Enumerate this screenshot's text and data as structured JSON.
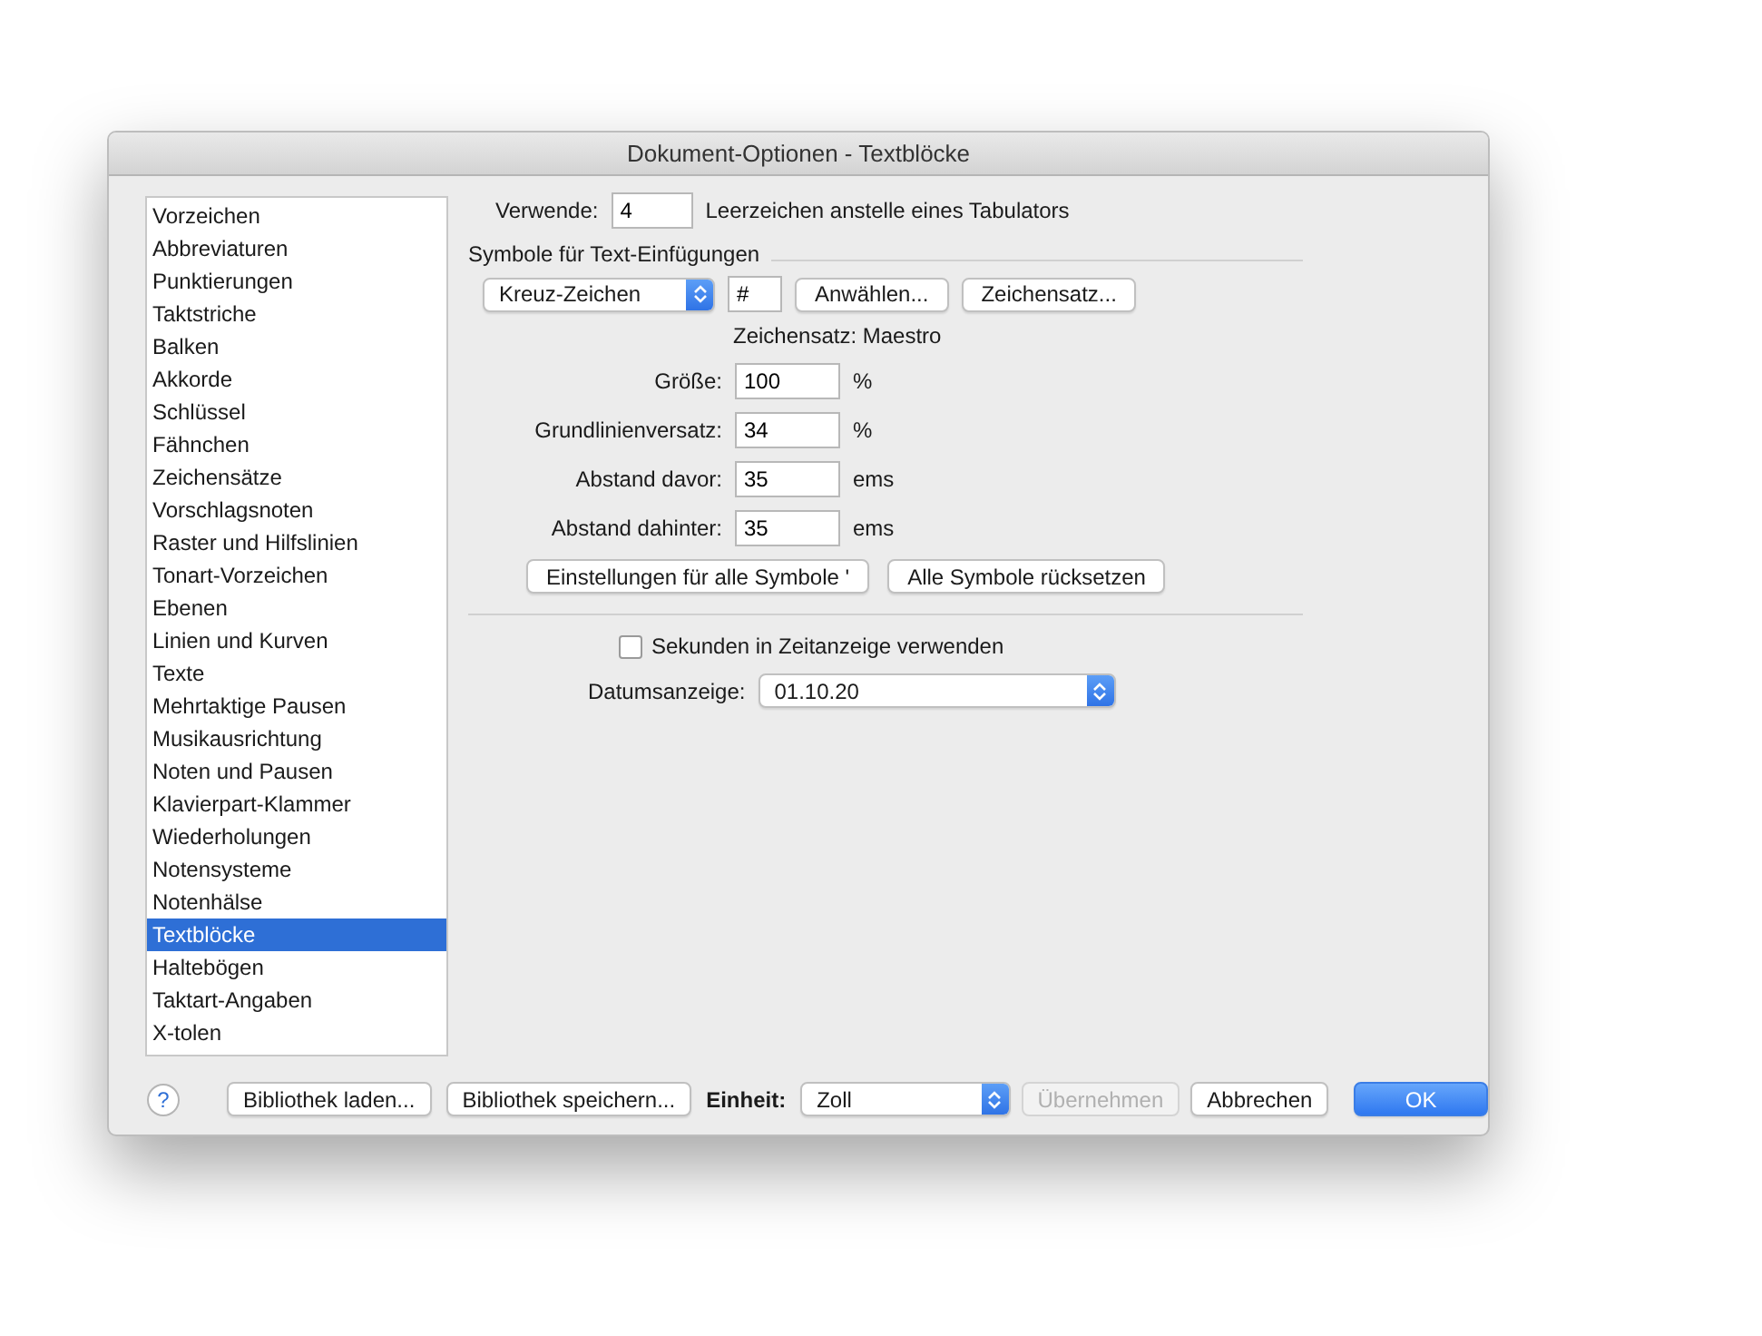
{
  "window": {
    "title": "Dokument-Optionen - Textblöcke"
  },
  "sidebar": {
    "items": [
      {
        "label": "Vorzeichen",
        "selected": false
      },
      {
        "label": "Abbreviaturen",
        "selected": false
      },
      {
        "label": "Punktierungen",
        "selected": false
      },
      {
        "label": "Taktstriche",
        "selected": false
      },
      {
        "label": "Balken",
        "selected": false
      },
      {
        "label": "Akkorde",
        "selected": false
      },
      {
        "label": "Schlüssel",
        "selected": false
      },
      {
        "label": "Fähnchen",
        "selected": false
      },
      {
        "label": "Zeichensätze",
        "selected": false
      },
      {
        "label": "Vorschlagsnoten",
        "selected": false
      },
      {
        "label": "Raster und Hilfslinien",
        "selected": false
      },
      {
        "label": "Tonart-Vorzeichen",
        "selected": false
      },
      {
        "label": "Ebenen",
        "selected": false
      },
      {
        "label": "Linien und Kurven",
        "selected": false
      },
      {
        "label": "Texte",
        "selected": false
      },
      {
        "label": "Mehrtaktige Pausen",
        "selected": false
      },
      {
        "label": "Musikausrichtung",
        "selected": false
      },
      {
        "label": "Noten und Pausen",
        "selected": false
      },
      {
        "label": "Klavierpart-Klammer",
        "selected": false
      },
      {
        "label": "Wiederholungen",
        "selected": false
      },
      {
        "label": "Notensysteme",
        "selected": false
      },
      {
        "label": "Notenhälse",
        "selected": false
      },
      {
        "label": "Textblöcke",
        "selected": true
      },
      {
        "label": "Haltebögen",
        "selected": false
      },
      {
        "label": "Taktart-Angaben",
        "selected": false
      },
      {
        "label": "X-tolen",
        "selected": false
      }
    ]
  },
  "spaces": {
    "label": "Verwende:",
    "value": "4",
    "suffix": "Leerzeichen anstelle eines Tabulators"
  },
  "symbols": {
    "heading": "Symbole für Text-Einfügungen",
    "popup": "Kreuz-Zeichen",
    "character": "#",
    "buttons": [
      "Anwählen...",
      "Zeichensatz..."
    ],
    "font_info": "Zeichensatz: Maestro",
    "fields": [
      {
        "label": "Größe:",
        "value": "100",
        "unit": "%"
      },
      {
        "label": "Grundlinienversatz:",
        "value": "34",
        "unit": "%"
      },
      {
        "label": "Abstand davor:",
        "value": "35",
        "unit": "ems"
      },
      {
        "label": "Abstand dahinter:",
        "value": "35",
        "unit": "ems"
      }
    ],
    "actions": [
      "Einstellungen für alle Symbole '",
      "Alle Symbole rücksetzen"
    ]
  },
  "seconds": {
    "label": "Sekunden in Zeitanzeige verwenden",
    "checked": false
  },
  "date": {
    "label": "Datumsanzeige:",
    "value": "01.10.20"
  },
  "footer": {
    "help": "?",
    "library_buttons": [
      "Bibliothek laden...",
      "Bibliothek speichern..."
    ],
    "unit_label": "Einheit:",
    "unit_value": "Zoll",
    "buttons": [
      {
        "label": "Übernehmen",
        "disabled": true,
        "default": false
      },
      {
        "label": "Abbrechen",
        "disabled": false,
        "default": false
      },
      {
        "label": "OK",
        "disabled": false,
        "default": true
      }
    ]
  }
}
